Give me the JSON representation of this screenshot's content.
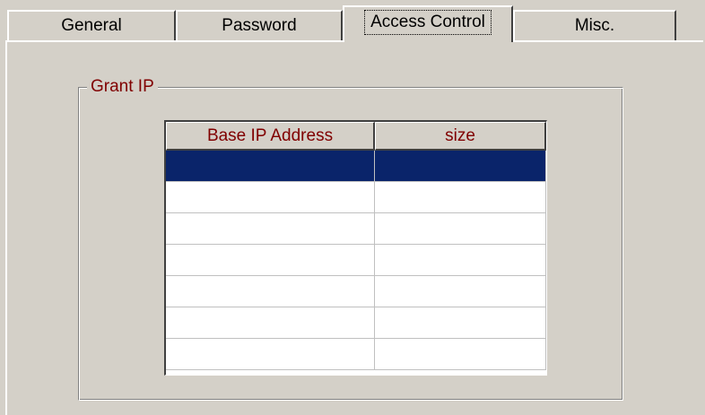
{
  "tabs": [
    {
      "label": "General",
      "active": false
    },
    {
      "label": "Password",
      "active": false
    },
    {
      "label": "Access Control",
      "active": true
    },
    {
      "label": "Misc.",
      "active": false
    }
  ],
  "grant_ip": {
    "title": "Grant IP",
    "columns": [
      "Base IP Address",
      "size"
    ],
    "selected_row": 0,
    "rows": [
      [
        "",
        ""
      ],
      [
        "",
        ""
      ],
      [
        "",
        ""
      ],
      [
        "",
        ""
      ],
      [
        "",
        ""
      ],
      [
        "",
        ""
      ],
      [
        "",
        ""
      ]
    ]
  },
  "colors": {
    "background": "#d4d0c8",
    "header_text": "#800000",
    "selection": "#0a246a"
  }
}
